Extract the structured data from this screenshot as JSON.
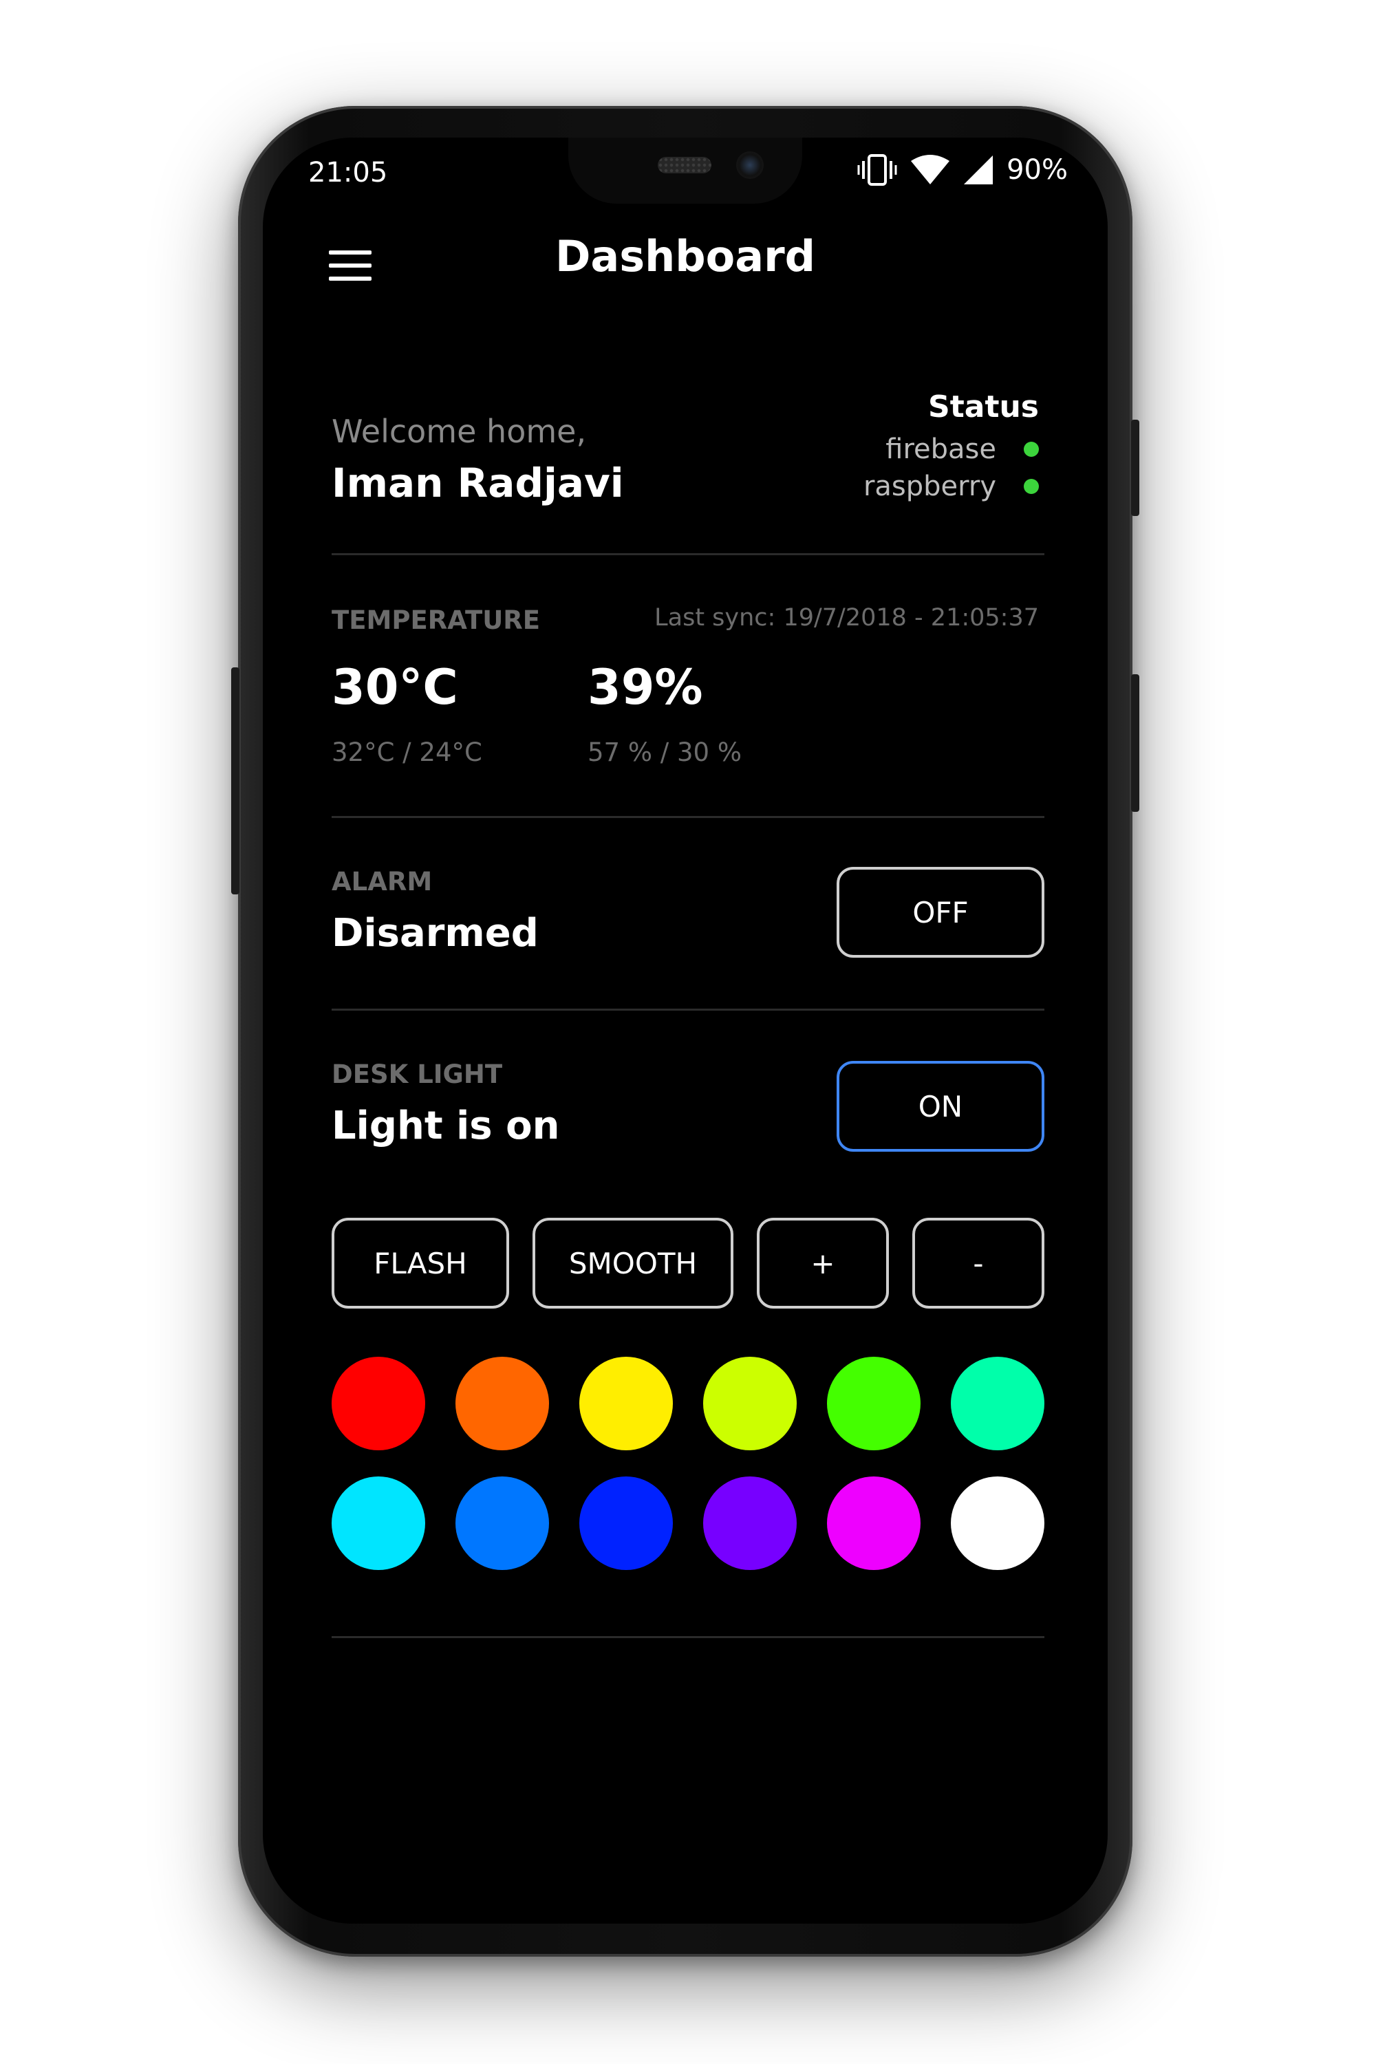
{
  "status_bar": {
    "time": "21:05",
    "battery": "90%",
    "icons": [
      "vibrate-icon",
      "wifi-icon",
      "cell-signal-icon"
    ]
  },
  "topbar": {
    "title": "Dashboard",
    "menu_icon": "hamburger-menu-icon"
  },
  "welcome": {
    "greeting": "Welcome home,",
    "name": "Iman Radjavi"
  },
  "status": {
    "title": "Status",
    "services": [
      {
        "name": "firebase",
        "color": "#3cd43c"
      },
      {
        "name": "raspberry",
        "color": "#3cd43c"
      }
    ]
  },
  "temperature": {
    "label": "TEMPERATURE",
    "last_sync": "Last sync: 19/7/2018 - 21:05:37",
    "temp_value": "30°C",
    "temp_range": "32°C / 24°C",
    "humidity_value": "39%",
    "humidity_range": "57 % / 30 %"
  },
  "alarm": {
    "label": "ALARM",
    "state": "Disarmed",
    "button": "OFF"
  },
  "desk_light": {
    "label": "DESK LIGHT",
    "state": "Light is on",
    "button": "ON",
    "active_color": "#3f86f4",
    "actions": [
      "FLASH",
      "SMOOTH",
      "+",
      "-"
    ]
  },
  "color_palette": [
    "#ff0000",
    "#ff6600",
    "#ffee00",
    "#ccff00",
    "#44ff00",
    "#00ffaa",
    "#00e5ff",
    "#0077ff",
    "#0022ff",
    "#7700ff",
    "#ee00ff",
    "#ffffff"
  ]
}
